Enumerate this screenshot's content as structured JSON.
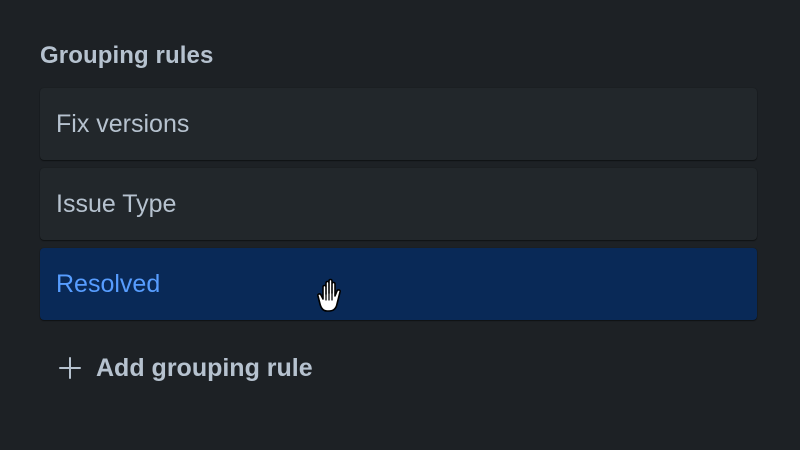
{
  "grouping": {
    "title": "Grouping rules",
    "rules": [
      {
        "label": "Fix versions"
      },
      {
        "label": "Issue Type"
      },
      {
        "label": "Resolved"
      }
    ],
    "add_label": "Add grouping rule"
  },
  "colors": {
    "background": "#1d2125",
    "card": "#22272b",
    "selected_card": "#092957",
    "selected_text": "#579dff",
    "text": "#b6c2cf"
  },
  "icons": {
    "add": "plus-icon",
    "cursor": "grab-hand-cursor-icon"
  }
}
